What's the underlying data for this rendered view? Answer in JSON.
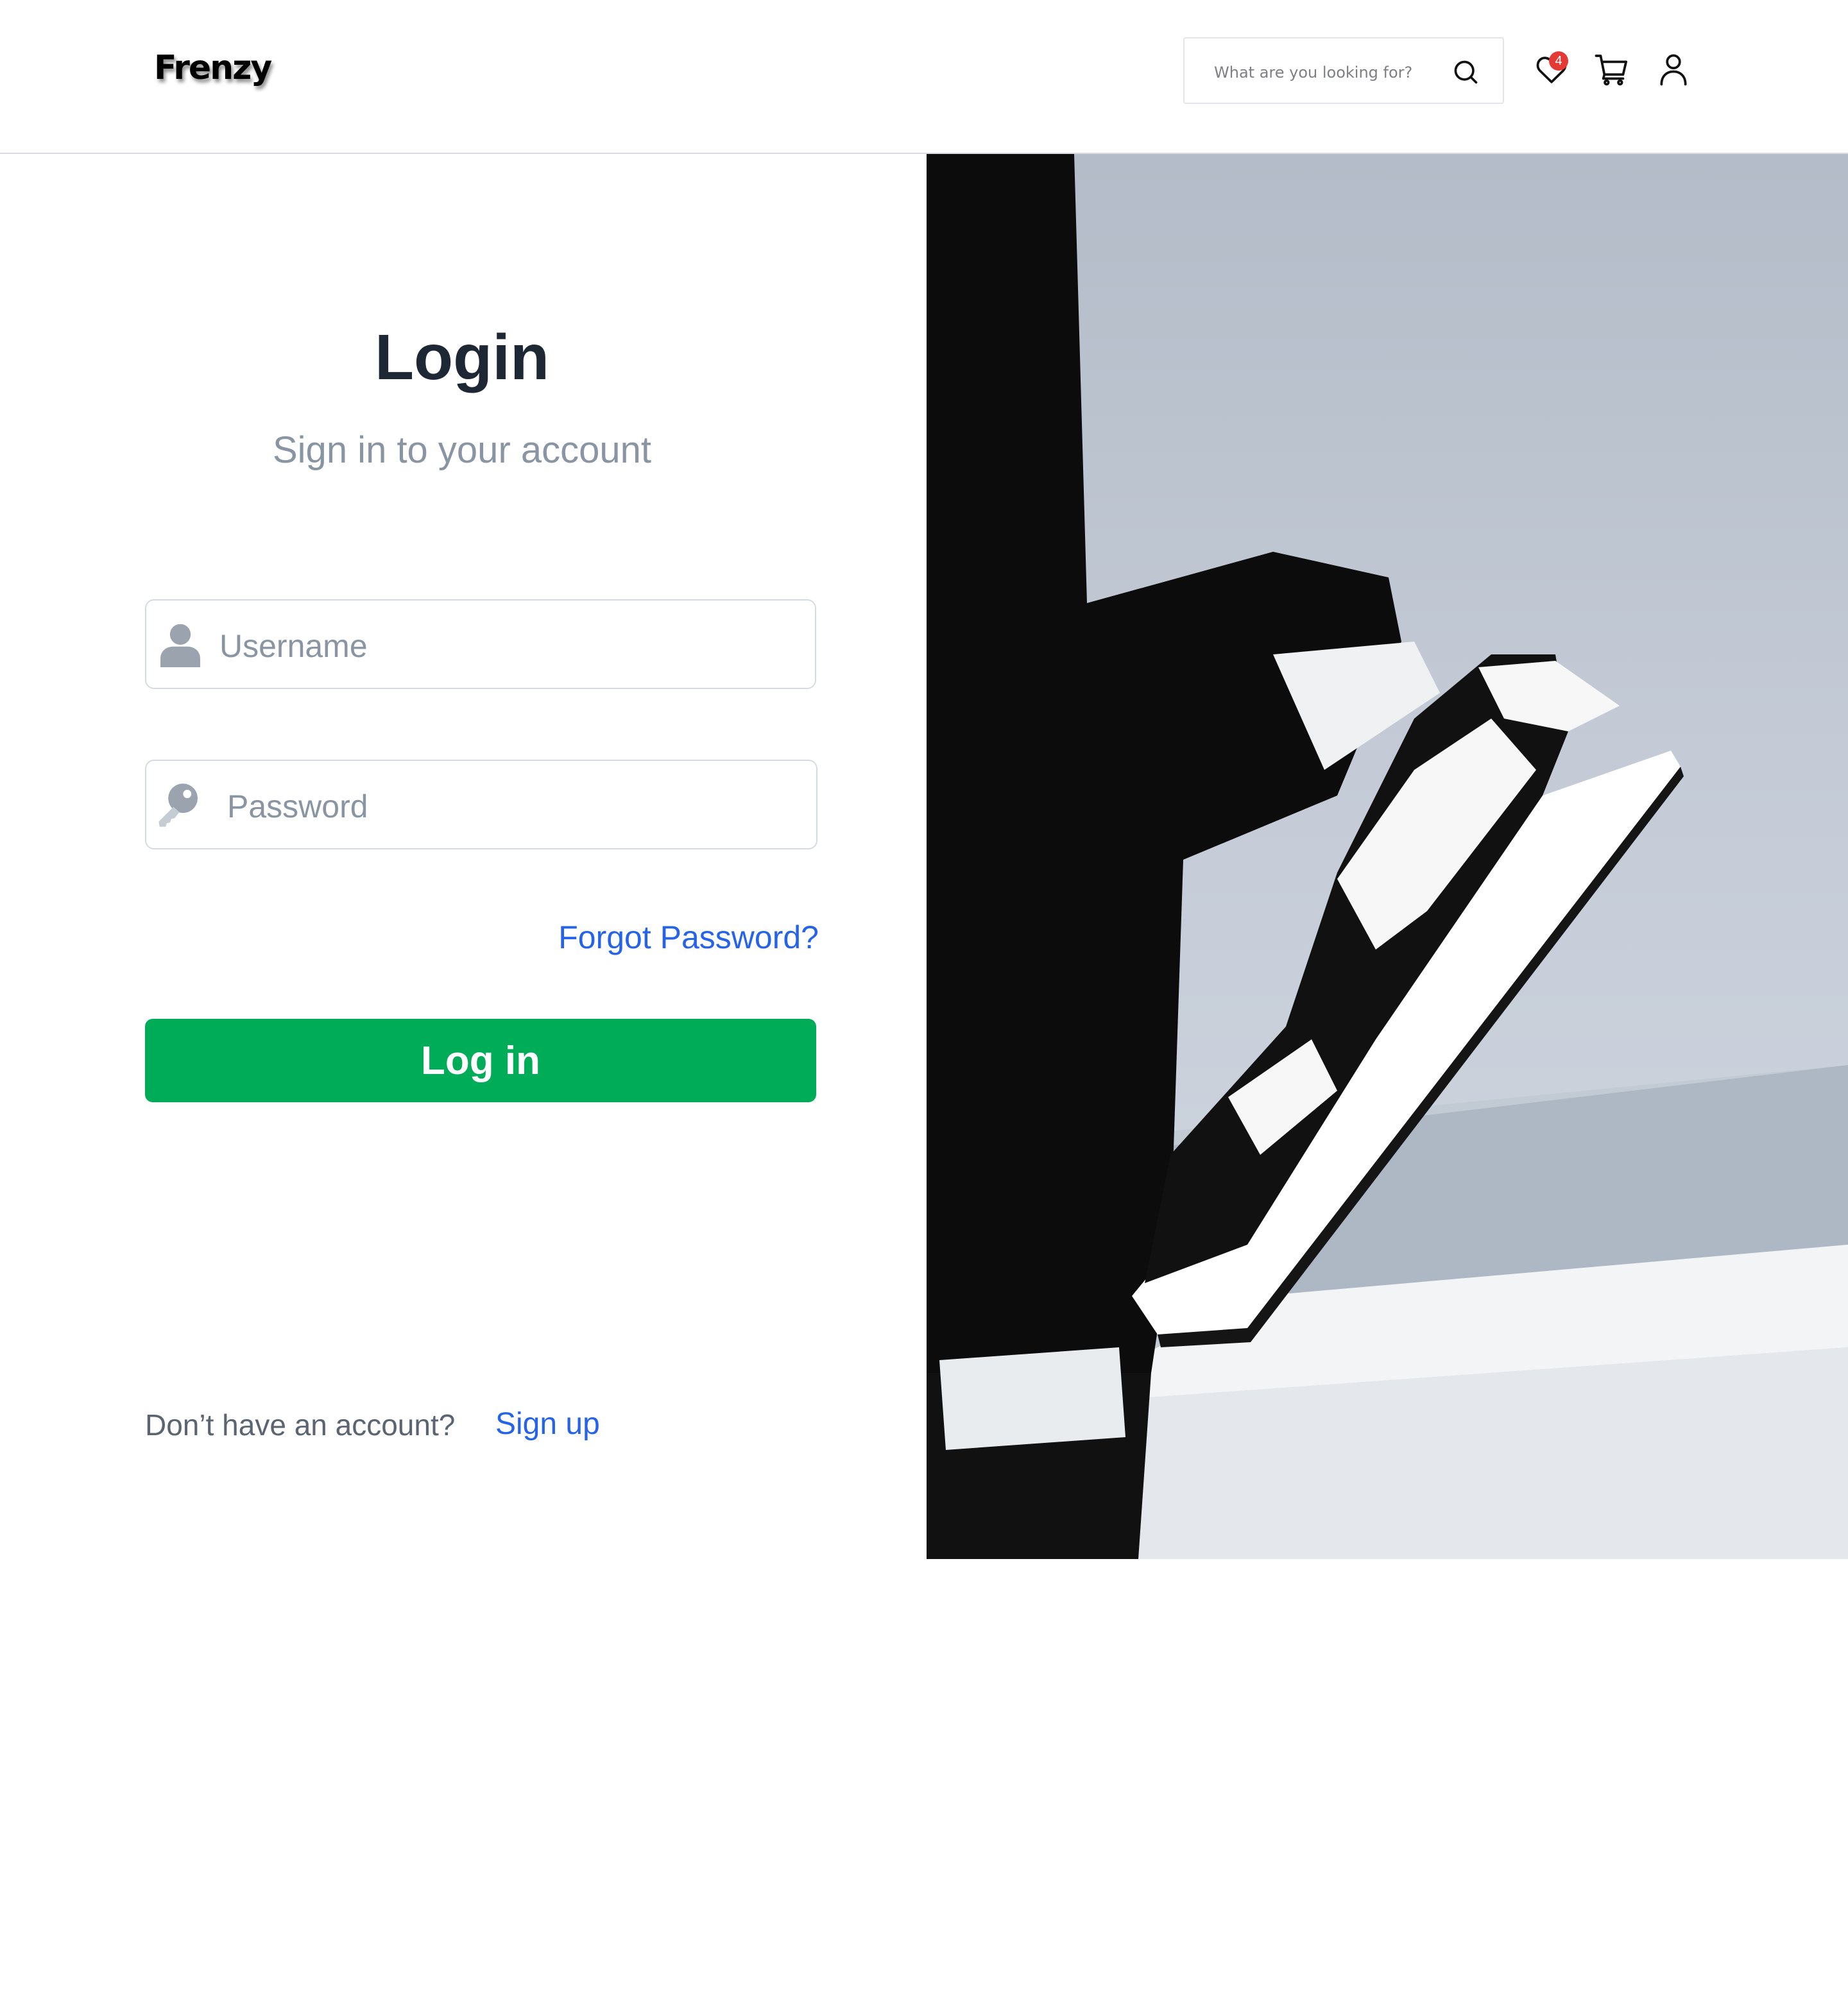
{
  "header": {
    "logo": "Frenzy",
    "search": {
      "placeholder": "What are you looking for?",
      "icon": "search-icon"
    },
    "icons": {
      "wishlist": "heart-icon",
      "cart": "cart-icon",
      "account": "user-icon"
    },
    "wishlist_count": "4"
  },
  "login": {
    "title": "Login",
    "subtitle": "Sign in to your account",
    "username_placeholder": "Username",
    "password_placeholder": "Password",
    "forgot_password": "Forgot Password?",
    "login_button": "Log in",
    "no_account_text": "Don’t have an account?",
    "signup_link": "Sign up"
  },
  "colors": {
    "accent_green": "#00ac58",
    "link_blue": "#2563eb",
    "title_dark": "#1e2835",
    "muted_gray": "#8a95a3",
    "badge_red": "#e53935"
  }
}
